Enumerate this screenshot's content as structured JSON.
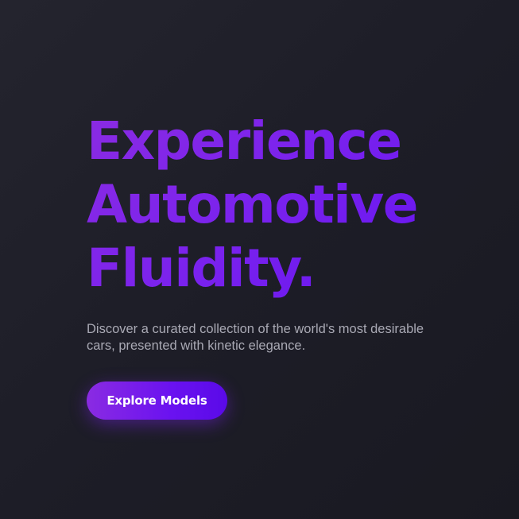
{
  "hero": {
    "headline_lines": [
      "Experience",
      "Automotive",
      "Fluidity."
    ],
    "subtitle": "Discover a curated collection of the world's most desirable cars, presented with kinetic elegance.",
    "cta_label": "Explore Models"
  },
  "colors": {
    "background": "#1e1e28",
    "accent_start": "#8a2be2",
    "accent_end": "#5a0ae8",
    "subtitle_text": "#a9a9b4",
    "button_text": "#ffffff"
  }
}
